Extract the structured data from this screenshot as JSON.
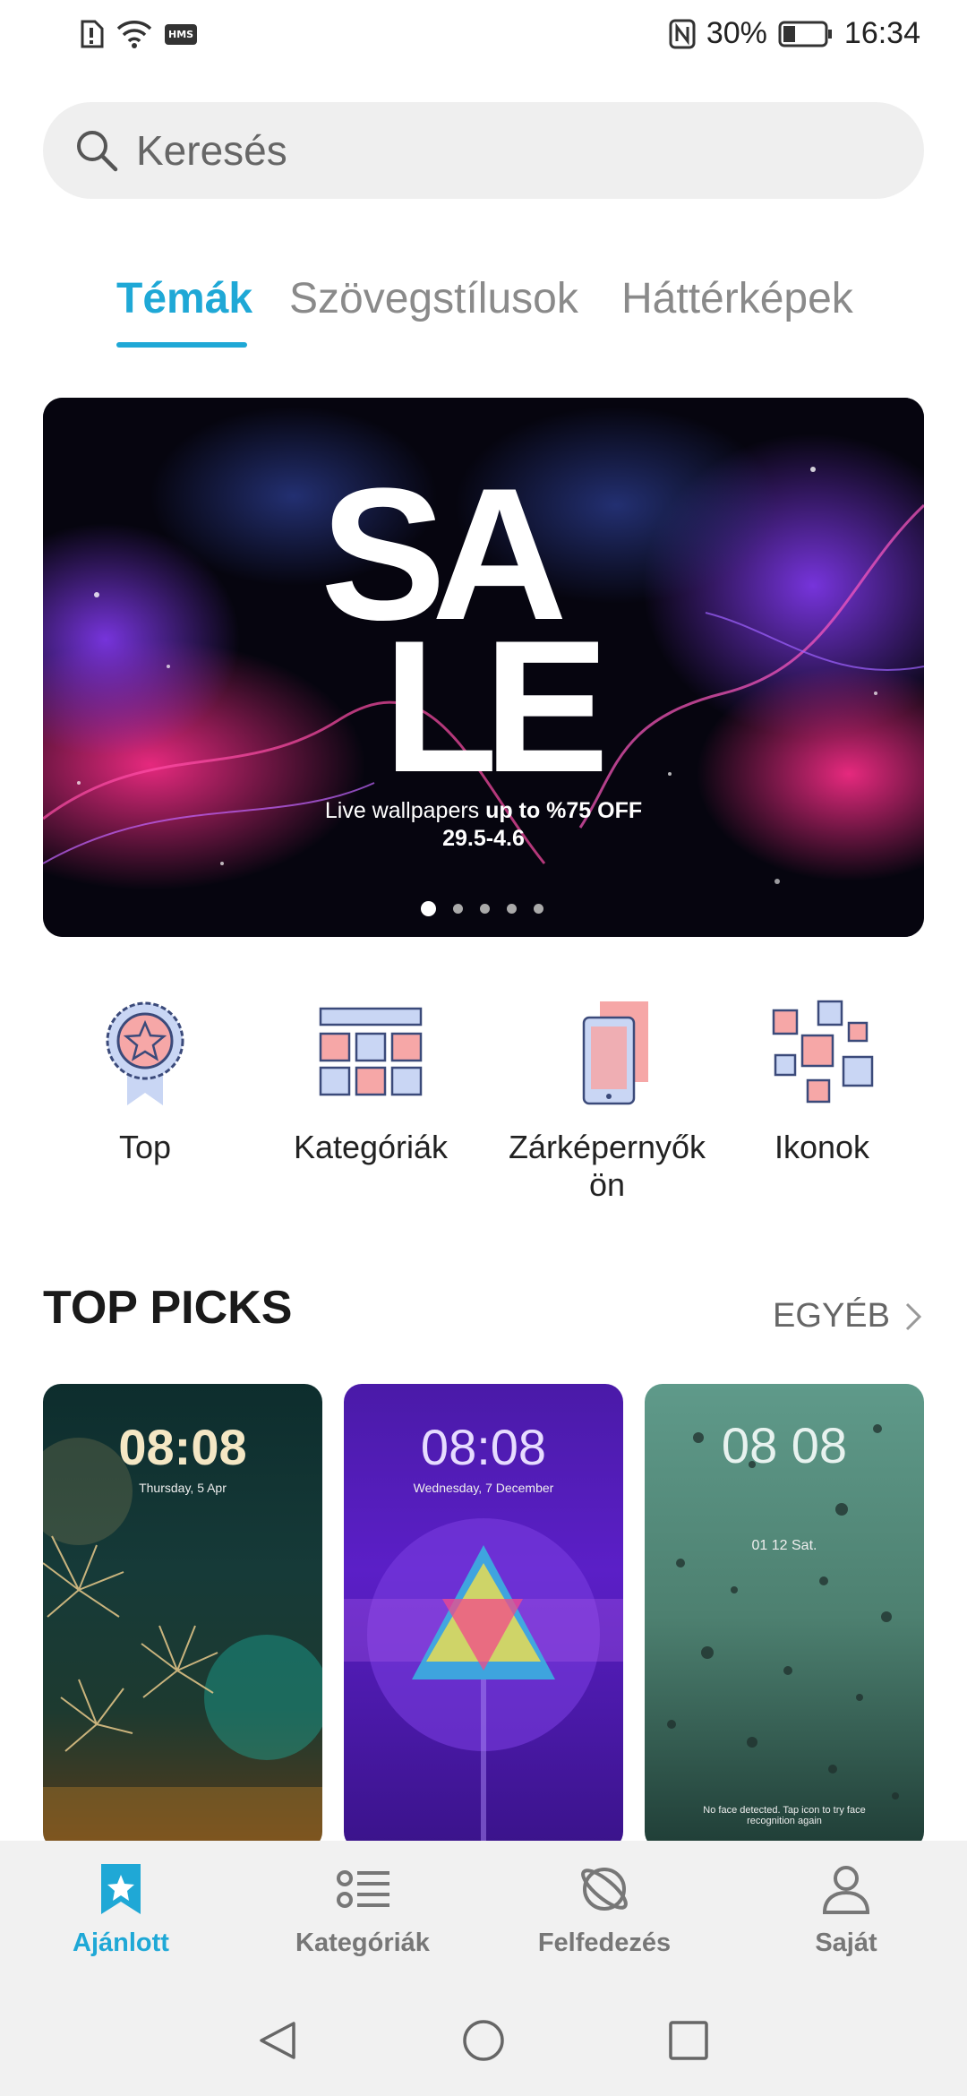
{
  "status_bar": {
    "icons_left": [
      "alert-icon",
      "wifi-icon",
      "hms-icon"
    ],
    "hms_label": "HMS",
    "nfc_icon": "nfc-icon",
    "battery_percent": "30%",
    "battery_level": 0.3,
    "time": "16:34"
  },
  "search": {
    "placeholder": "Keresés",
    "icon": "search-icon"
  },
  "tabs": [
    {
      "label": "Témák",
      "active": true
    },
    {
      "label": "Szövegstílusok",
      "active": false
    },
    {
      "label": "Háttérképek",
      "active": false
    }
  ],
  "banner": {
    "headline_line1": "SA",
    "headline_line2": "LE",
    "subtitle_prefix": "Live wallpapers ",
    "subtitle_bold": "up to %75 OFF",
    "dates": "29.5-4.6",
    "page_count": 5,
    "active_page": 0
  },
  "categories": [
    {
      "label": "Top",
      "icon": "award-ribbon-icon"
    },
    {
      "label": "Kategóriák",
      "icon": "category-grid-icon"
    },
    {
      "label": "Zárképernyők ön",
      "icon": "lockscreen-icon"
    },
    {
      "label": "Ikonok",
      "icon": "icons-icon"
    }
  ],
  "top_picks": {
    "title": "TOP PICKS",
    "more_label": "EGYÉB",
    "cards": [
      {
        "time": "08:08",
        "date": "Thursday, 5 Apr"
      },
      {
        "time": "08:08",
        "date": "Wednesday, 7 December"
      },
      {
        "time": "08 08",
        "date": "01 12  Sat.",
        "note": "No face detected. Tap icon to try face recognition again"
      }
    ]
  },
  "bottom_nav": [
    {
      "label": "Ajánlott",
      "icon": "star-bookmark-icon",
      "active": true
    },
    {
      "label": "Kategóriák",
      "icon": "list-icon",
      "active": false
    },
    {
      "label": "Felfedezés",
      "icon": "planet-icon",
      "active": false
    },
    {
      "label": "Saját",
      "icon": "person-icon",
      "active": false
    }
  ],
  "system_nav": [
    "back-icon",
    "home-icon",
    "recents-icon"
  ],
  "colors": {
    "accent": "#1fa8d6",
    "pink": "#f6a7a7",
    "lavender": "#c9d6f4"
  }
}
